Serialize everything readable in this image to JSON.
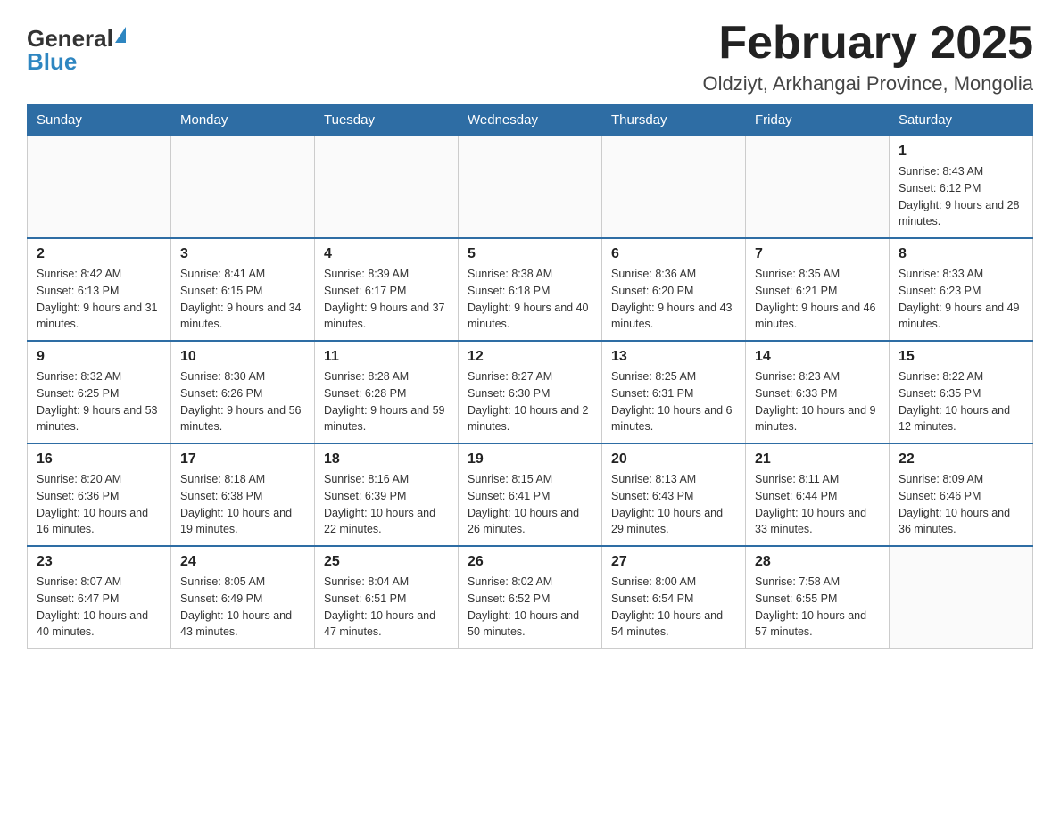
{
  "header": {
    "logo_general": "General",
    "logo_blue": "Blue",
    "title": "February 2025",
    "subtitle": "Oldziyt, Arkhangai Province, Mongolia"
  },
  "days_of_week": [
    "Sunday",
    "Monday",
    "Tuesday",
    "Wednesday",
    "Thursday",
    "Friday",
    "Saturday"
  ],
  "weeks": [
    [
      {
        "day": "",
        "info": ""
      },
      {
        "day": "",
        "info": ""
      },
      {
        "day": "",
        "info": ""
      },
      {
        "day": "",
        "info": ""
      },
      {
        "day": "",
        "info": ""
      },
      {
        "day": "",
        "info": ""
      },
      {
        "day": "1",
        "info": "Sunrise: 8:43 AM\nSunset: 6:12 PM\nDaylight: 9 hours and 28 minutes."
      }
    ],
    [
      {
        "day": "2",
        "info": "Sunrise: 8:42 AM\nSunset: 6:13 PM\nDaylight: 9 hours and 31 minutes."
      },
      {
        "day": "3",
        "info": "Sunrise: 8:41 AM\nSunset: 6:15 PM\nDaylight: 9 hours and 34 minutes."
      },
      {
        "day": "4",
        "info": "Sunrise: 8:39 AM\nSunset: 6:17 PM\nDaylight: 9 hours and 37 minutes."
      },
      {
        "day": "5",
        "info": "Sunrise: 8:38 AM\nSunset: 6:18 PM\nDaylight: 9 hours and 40 minutes."
      },
      {
        "day": "6",
        "info": "Sunrise: 8:36 AM\nSunset: 6:20 PM\nDaylight: 9 hours and 43 minutes."
      },
      {
        "day": "7",
        "info": "Sunrise: 8:35 AM\nSunset: 6:21 PM\nDaylight: 9 hours and 46 minutes."
      },
      {
        "day": "8",
        "info": "Sunrise: 8:33 AM\nSunset: 6:23 PM\nDaylight: 9 hours and 49 minutes."
      }
    ],
    [
      {
        "day": "9",
        "info": "Sunrise: 8:32 AM\nSunset: 6:25 PM\nDaylight: 9 hours and 53 minutes."
      },
      {
        "day": "10",
        "info": "Sunrise: 8:30 AM\nSunset: 6:26 PM\nDaylight: 9 hours and 56 minutes."
      },
      {
        "day": "11",
        "info": "Sunrise: 8:28 AM\nSunset: 6:28 PM\nDaylight: 9 hours and 59 minutes."
      },
      {
        "day": "12",
        "info": "Sunrise: 8:27 AM\nSunset: 6:30 PM\nDaylight: 10 hours and 2 minutes."
      },
      {
        "day": "13",
        "info": "Sunrise: 8:25 AM\nSunset: 6:31 PM\nDaylight: 10 hours and 6 minutes."
      },
      {
        "day": "14",
        "info": "Sunrise: 8:23 AM\nSunset: 6:33 PM\nDaylight: 10 hours and 9 minutes."
      },
      {
        "day": "15",
        "info": "Sunrise: 8:22 AM\nSunset: 6:35 PM\nDaylight: 10 hours and 12 minutes."
      }
    ],
    [
      {
        "day": "16",
        "info": "Sunrise: 8:20 AM\nSunset: 6:36 PM\nDaylight: 10 hours and 16 minutes."
      },
      {
        "day": "17",
        "info": "Sunrise: 8:18 AM\nSunset: 6:38 PM\nDaylight: 10 hours and 19 minutes."
      },
      {
        "day": "18",
        "info": "Sunrise: 8:16 AM\nSunset: 6:39 PM\nDaylight: 10 hours and 22 minutes."
      },
      {
        "day": "19",
        "info": "Sunrise: 8:15 AM\nSunset: 6:41 PM\nDaylight: 10 hours and 26 minutes."
      },
      {
        "day": "20",
        "info": "Sunrise: 8:13 AM\nSunset: 6:43 PM\nDaylight: 10 hours and 29 minutes."
      },
      {
        "day": "21",
        "info": "Sunrise: 8:11 AM\nSunset: 6:44 PM\nDaylight: 10 hours and 33 minutes."
      },
      {
        "day": "22",
        "info": "Sunrise: 8:09 AM\nSunset: 6:46 PM\nDaylight: 10 hours and 36 minutes."
      }
    ],
    [
      {
        "day": "23",
        "info": "Sunrise: 8:07 AM\nSunset: 6:47 PM\nDaylight: 10 hours and 40 minutes."
      },
      {
        "day": "24",
        "info": "Sunrise: 8:05 AM\nSunset: 6:49 PM\nDaylight: 10 hours and 43 minutes."
      },
      {
        "day": "25",
        "info": "Sunrise: 8:04 AM\nSunset: 6:51 PM\nDaylight: 10 hours and 47 minutes."
      },
      {
        "day": "26",
        "info": "Sunrise: 8:02 AM\nSunset: 6:52 PM\nDaylight: 10 hours and 50 minutes."
      },
      {
        "day": "27",
        "info": "Sunrise: 8:00 AM\nSunset: 6:54 PM\nDaylight: 10 hours and 54 minutes."
      },
      {
        "day": "28",
        "info": "Sunrise: 7:58 AM\nSunset: 6:55 PM\nDaylight: 10 hours and 57 minutes."
      },
      {
        "day": "",
        "info": ""
      }
    ]
  ]
}
